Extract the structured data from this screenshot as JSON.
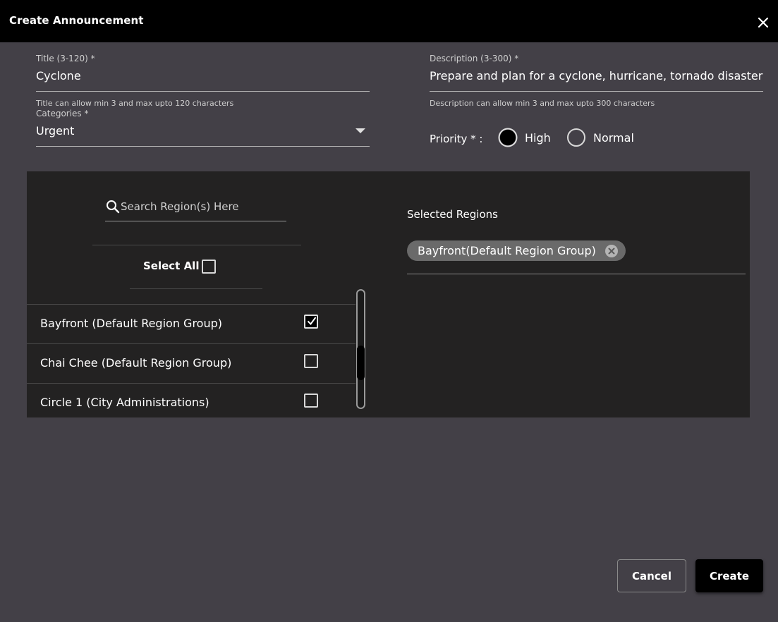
{
  "header": {
    "title": "Create Announcement",
    "close_icon": "close-icon"
  },
  "form": {
    "title_field": {
      "label": "Title (3-120) *",
      "value": "Cyclone",
      "helper": "Title can allow min 3 and max upto 120 characters"
    },
    "description_field": {
      "label": "Description (3-300) *",
      "value": "Prepare and plan for a cyclone, hurricane, tornado disaster",
      "helper": "Description can allow min 3 and max upto 300 characters"
    },
    "category_field": {
      "label": "Categories *",
      "value": "Urgent"
    },
    "priority": {
      "label": "Priority * :",
      "options": [
        {
          "label": "High",
          "selected": true
        },
        {
          "label": "Normal",
          "selected": false
        }
      ]
    }
  },
  "regions": {
    "search_placeholder": "Search Region(s) Here",
    "select_all_label": "Select All",
    "select_all_checked": false,
    "items": [
      {
        "label": "Bayfront (Default Region Group)",
        "checked": true
      },
      {
        "label": "Chai Chee (Default Region Group)",
        "checked": false
      },
      {
        "label": "Circle 1 (City Administrations)",
        "checked": false
      }
    ],
    "selected_title": "Selected Regions",
    "selected_chips": [
      {
        "label": "Bayfront(Default Region Group)"
      }
    ]
  },
  "actions": {
    "cancel_label": "Cancel",
    "create_label": "Create"
  },
  "colors": {
    "background": "#434047",
    "header": "#000000",
    "panel": "#232222",
    "chip": "#6a6a6a"
  }
}
